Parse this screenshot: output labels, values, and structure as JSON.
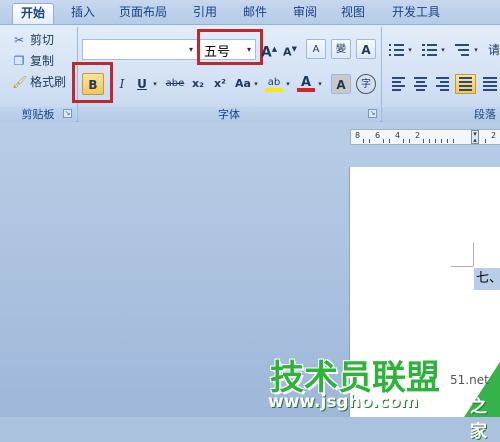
{
  "tabs": [
    "开始",
    "插入",
    "页面布局",
    "引用",
    "邮件",
    "审阅",
    "视图",
    "开发工具"
  ],
  "clipboard": {
    "cut_label": "剪切",
    "copy_label": "复制",
    "format_painter_label": "格式刷",
    "group_label": "剪贴板"
  },
  "font": {
    "font_name_value": "",
    "font_size_value": "五号",
    "bold_label": "B",
    "italic_label": "I",
    "underline_label": "U",
    "strike_label": "abe",
    "subscript_label": "x₂",
    "superscript_label": "x²",
    "change_case_label": "Aa",
    "grow_label": "A",
    "shrink_label": "A",
    "clear_format_label": "A",
    "phonetic_label": "變",
    "border_label": "A",
    "highlight_label": "ab",
    "font_color_label": "A",
    "shade_label": "A",
    "enclose_label": "字",
    "group_label": "字体"
  },
  "paragraph": {
    "group_label": "段落",
    "fragment_label": "请"
  },
  "ruler": {
    "numbers": [
      "8",
      "6",
      "4",
      "2",
      "2"
    ]
  },
  "document": {
    "selected_text": "七、"
  },
  "watermark": {
    "title": "技术员联盟",
    "url": "www.jsgho.com",
    "tail": "之家",
    "fragment": "51.net"
  },
  "colors": {
    "accent": "#15428b",
    "highlight_yellow": "#f6e71c",
    "font_color_red": "#d1272a",
    "annotation_red": "#c0282e",
    "watermark_green": "#2db33a"
  }
}
